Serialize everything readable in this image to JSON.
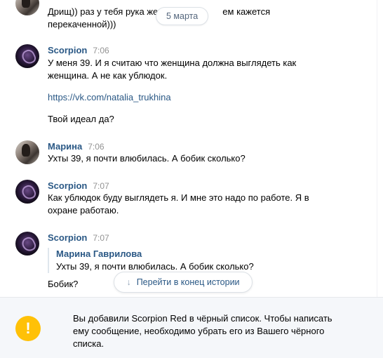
{
  "conversation": {
    "date_badge": "5 марта",
    "top_partial_text": "Дрищ)) раз у тебя рука же",
    "top_partial_text_right": "ем кажется",
    "top_partial_text_line2": "перекаченной)))",
    "messages": [
      {
        "author": "Scorpion",
        "time": "7:06",
        "avatar": "scorpion-avatar-icon",
        "lines": [
          "У меня 39. И я считаю что женщина должна выглядеть как",
          "женщина. А не как ублюдок."
        ],
        "link": "https://vk.com/natalia_trukhina",
        "extra": "Твой идеал да?"
      },
      {
        "author": "Марина",
        "time": "7:06",
        "avatar": "marina-avatar-icon",
        "lines": [
          "Ухты 39, я почти влюбилась. А бобик сколько?"
        ]
      },
      {
        "author": "Scorpion",
        "time": "7:07",
        "avatar": "scorpion-avatar-icon",
        "lines": [
          "Как ублюдок буду выглядеть я. И мне это надо по работе. Я в",
          "охране работаю."
        ]
      },
      {
        "author": "Scorpion",
        "time": "7:07",
        "avatar": "scorpion-avatar-icon",
        "quote_author": "Марина Гаврилова",
        "quote_text": "Ухты 39, я почти влюбилась. А бобик сколько?",
        "lines": [
          "Бобик?"
        ]
      }
    ]
  },
  "jump_button": {
    "icon": "arrow-down-icon",
    "label": "Перейти в конец истории"
  },
  "notice": {
    "icon": "exclamation-icon",
    "text": "Вы добавили Scorpion Red в чёрный список. Чтобы написать ему сообщение, необходимо убрать его из Вашего чёрного списка."
  },
  "colors": {
    "author": "#2a5885",
    "time": "#939393",
    "warning": "#ffc107",
    "notice_bg": "#f5f7fa"
  }
}
